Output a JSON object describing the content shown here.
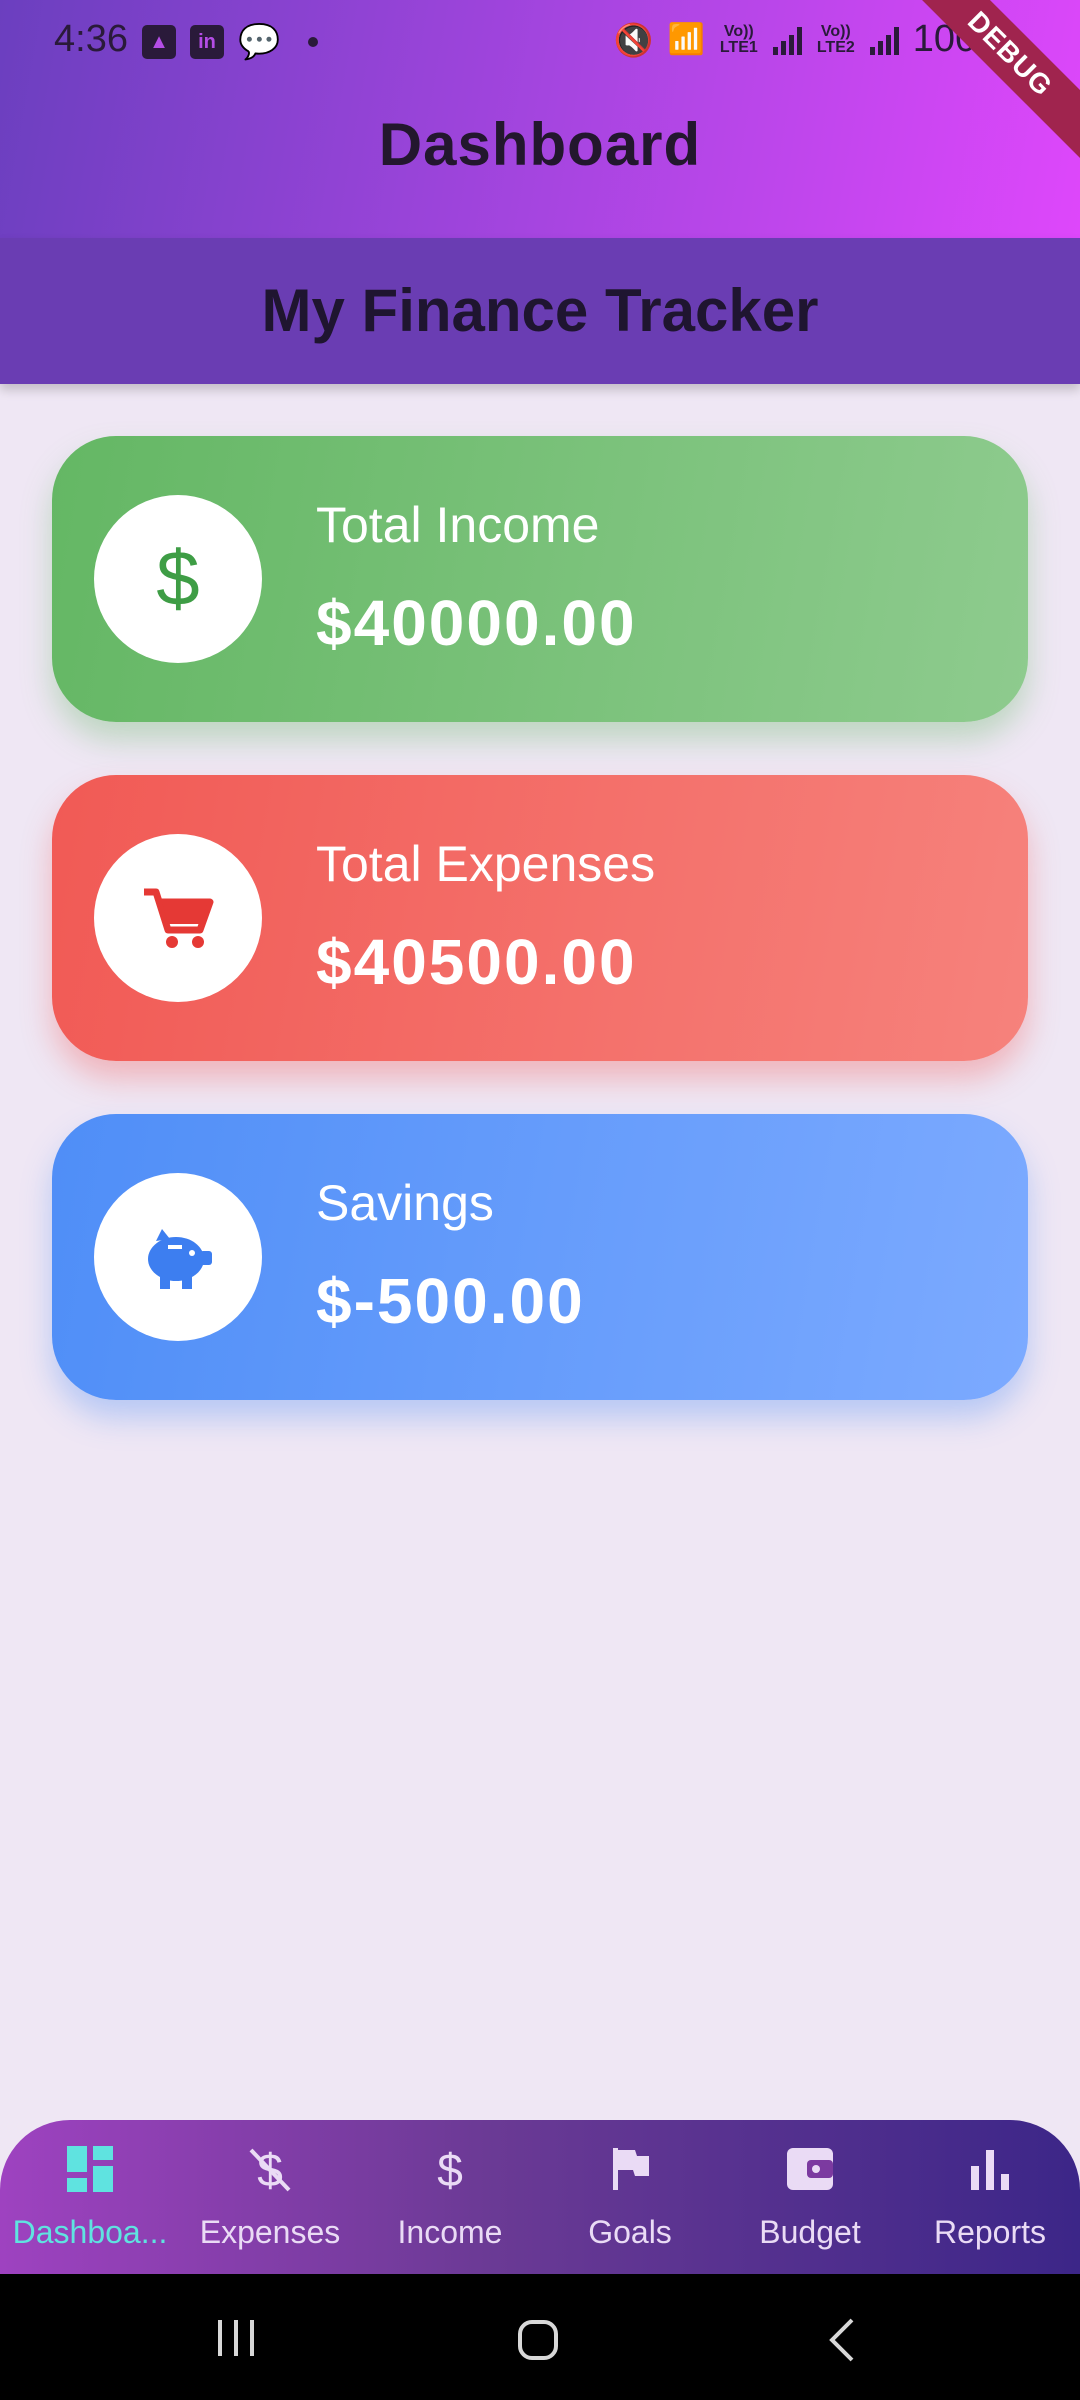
{
  "status_bar": {
    "time": "4:36",
    "battery": "100%",
    "sim1": "Vo)) LTE1",
    "sim2": "Vo)) LTE2"
  },
  "app_bar": {
    "title": "Dashboard",
    "debug_label": "DEBUG"
  },
  "header": {
    "title": "My Finance Tracker"
  },
  "cards": [
    {
      "label": "Total Income",
      "amount": "$40000.00",
      "icon": "dollar-icon",
      "color": "#64b764"
    },
    {
      "label": "Total Expenses",
      "amount": "$40500.00",
      "icon": "cart-icon",
      "color": "#f15a55"
    },
    {
      "label": "Savings",
      "amount": "$-500.00",
      "icon": "piggy-bank-icon",
      "color": "#4f8ef7"
    }
  ],
  "bottom_nav": {
    "items": [
      {
        "label": "Dashboa...",
        "icon": "dashboard-icon",
        "active": true
      },
      {
        "label": "Expenses",
        "icon": "money-off-icon"
      },
      {
        "label": "Income",
        "icon": "dollar-icon"
      },
      {
        "label": "Goals",
        "icon": "flag-icon"
      },
      {
        "label": "Budget",
        "icon": "wallet-icon"
      },
      {
        "label": "Reports",
        "icon": "bar-chart-icon"
      }
    ],
    "active_color": "#5fe3e0"
  }
}
